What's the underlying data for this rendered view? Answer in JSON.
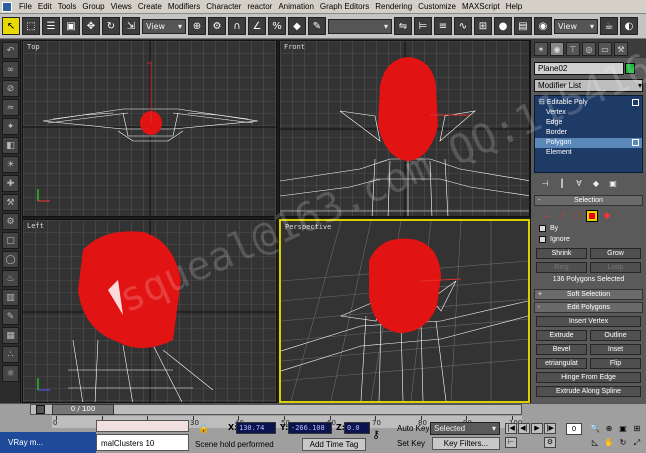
{
  "menubar": {
    "items": [
      "File",
      "Edit",
      "Tools",
      "Group",
      "Views",
      "Create",
      "Modifiers",
      "Character",
      "reactor",
      "Animation",
      "Graph Editors",
      "Rendering",
      "Customize",
      "MAXScript",
      "Help"
    ]
  },
  "toolbar": {
    "view_dropdown_1": "View",
    "view_dropdown_2": "View"
  },
  "viewports": {
    "top_label": "Top",
    "front_label": "Front",
    "left_label": "Left",
    "perspective_label": "Perspective",
    "watermark": "squeal@163.com  QQ:115416"
  },
  "command_panel": {
    "object_name": "Plane02",
    "object_color": "#1ab63a",
    "modifier_list": "Modifier List",
    "stack": {
      "root": "Editable Poly",
      "items": [
        "Vertex",
        "Edge",
        "Border",
        "Polygon",
        "Element"
      ],
      "selected_index": 3
    },
    "selection": {
      "title": "Selection",
      "by_label": "By",
      "ignore_label": "Ignore",
      "shrink": "Shrink",
      "grow": "Grow",
      "ring": "Ring",
      "loop": "Loop",
      "status": "136 Polygons Selected"
    },
    "soft_selection": "Soft Selection",
    "edit_polygons": {
      "title": "Edit Polygons",
      "insert_vertex": "Insert Vertex",
      "extrude": "Extrude",
      "outline": "Outline",
      "bevel": "Bevel",
      "inset": "Inset",
      "retriangulate": "etriangulat",
      "flip": "Flip",
      "hinge": "Hinge From Edge",
      "extrude_spline": "Extrude Along Spline"
    }
  },
  "timeline": {
    "slider": "0 / 100",
    "ticks": [
      0,
      10,
      20,
      30,
      40,
      50,
      60,
      70,
      80,
      90,
      100
    ]
  },
  "status": {
    "taskbar_item": "VRay m...",
    "clusters": "malClusters 10",
    "message": "Scene hold performed",
    "add_time_tag": "Add Time Tag",
    "x_label": "X:",
    "x_value": "130.74",
    "y_label": "Y:",
    "y_value": "-266.108",
    "z_label": "Z:",
    "z_value": "0.0",
    "auto_key": "Auto Key",
    "selected": "Selected",
    "set_key": "Set Key",
    "key_filters": "Key Filters...",
    "frame": "0"
  }
}
